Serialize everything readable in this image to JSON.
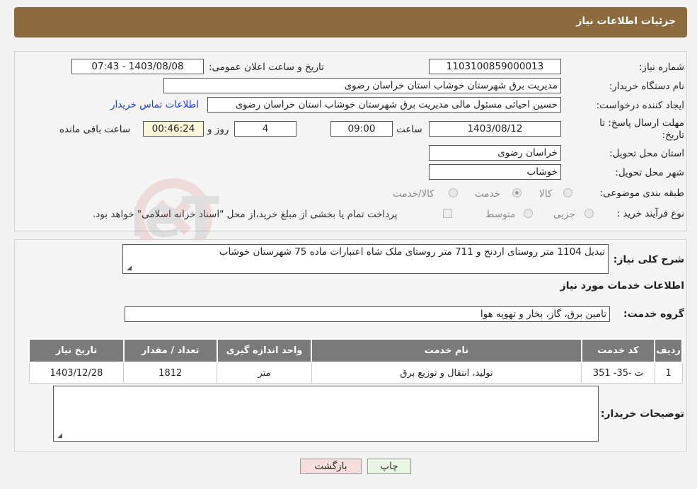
{
  "header": {
    "title": "جزئیات اطلاعات نیاز"
  },
  "form": {
    "need_number_label": "شماره نیاز:",
    "need_number": "1103100859000013",
    "announce_label": "تاریخ و ساعت اعلان عمومی:",
    "announce_value": "1403/08/08 - 07:43",
    "buyer_label": "نام دستگاه خریدار:",
    "buyer_value": "مدیریت برق شهرستان خوشاب استان خراسان رضوی",
    "creator_label": "ایجاد کننده درخواست:",
    "creator_value": "حسین احیائی مسئول مالی مدیریت برق شهرستان خوشاب استان خراسان رضوی",
    "contact_link": "اطلاعات تماس خریدار",
    "deadline_label": "مهلت ارسال پاسخ: تا تاریخ:",
    "deadline_date": "1403/08/12",
    "time_label": "ساعت",
    "deadline_time": "09:00",
    "days_value": "4",
    "days_label": "روز و",
    "remaining_value": "00:46:24",
    "remaining_label": "ساعت باقی مانده",
    "province_label": "استان محل تحویل:",
    "province_value": "خراسان رضوی",
    "city_label": "شهر محل تحویل:",
    "city_value": "خوشاب",
    "category_label": "طبقه بندی موضوعی:",
    "category_options": [
      "کالا",
      "خدمت",
      "کالا/خدمت"
    ],
    "category_selected": "خدمت",
    "process_label": "نوع فرآیند خرید :",
    "process_options": [
      "جزیی",
      "متوسط"
    ],
    "payment_note": "پرداخت تمام یا بخشی از مبلغ خرید،از محل \"اسناد خزانه اسلامی\" خواهد بود."
  },
  "summary": {
    "label": "شرح کلی نیاز:",
    "value": "تبدیل 1104 متر روستای اردنج و 711 متر روستای ملک شاه اعتبارات ماده 75 شهرستان خوشاب"
  },
  "services": {
    "section_title": "اطلاعات خدمات مورد نیاز",
    "group_label": "گروه خدمت:",
    "group_value": "تامین برق، گاز، بخار و تهویه هوا",
    "columns": [
      "ردیف",
      "کد خدمت",
      "نام خدمت",
      "واحد اندازه گیری",
      "تعداد / مقدار",
      "تاریخ نیاز"
    ],
    "rows": [
      [
        "1",
        "ت -35- 351",
        "تولید، انتقال و توزیع برق",
        "متر",
        "1812",
        "1403/12/28"
      ]
    ]
  },
  "buyer_notes": {
    "label": "توضیحات خریدار:",
    "value": ""
  },
  "buttons": {
    "print": "چاپ",
    "back": "بازگشت"
  },
  "watermark_text": "AriaTender.neT",
  "colors": {
    "header_bg": "#8b6b3e",
    "table_header": "#7a7a7a",
    "link": "#1a3fd6",
    "back_button": "#f7dede",
    "print_button": "#eaf6e4"
  }
}
